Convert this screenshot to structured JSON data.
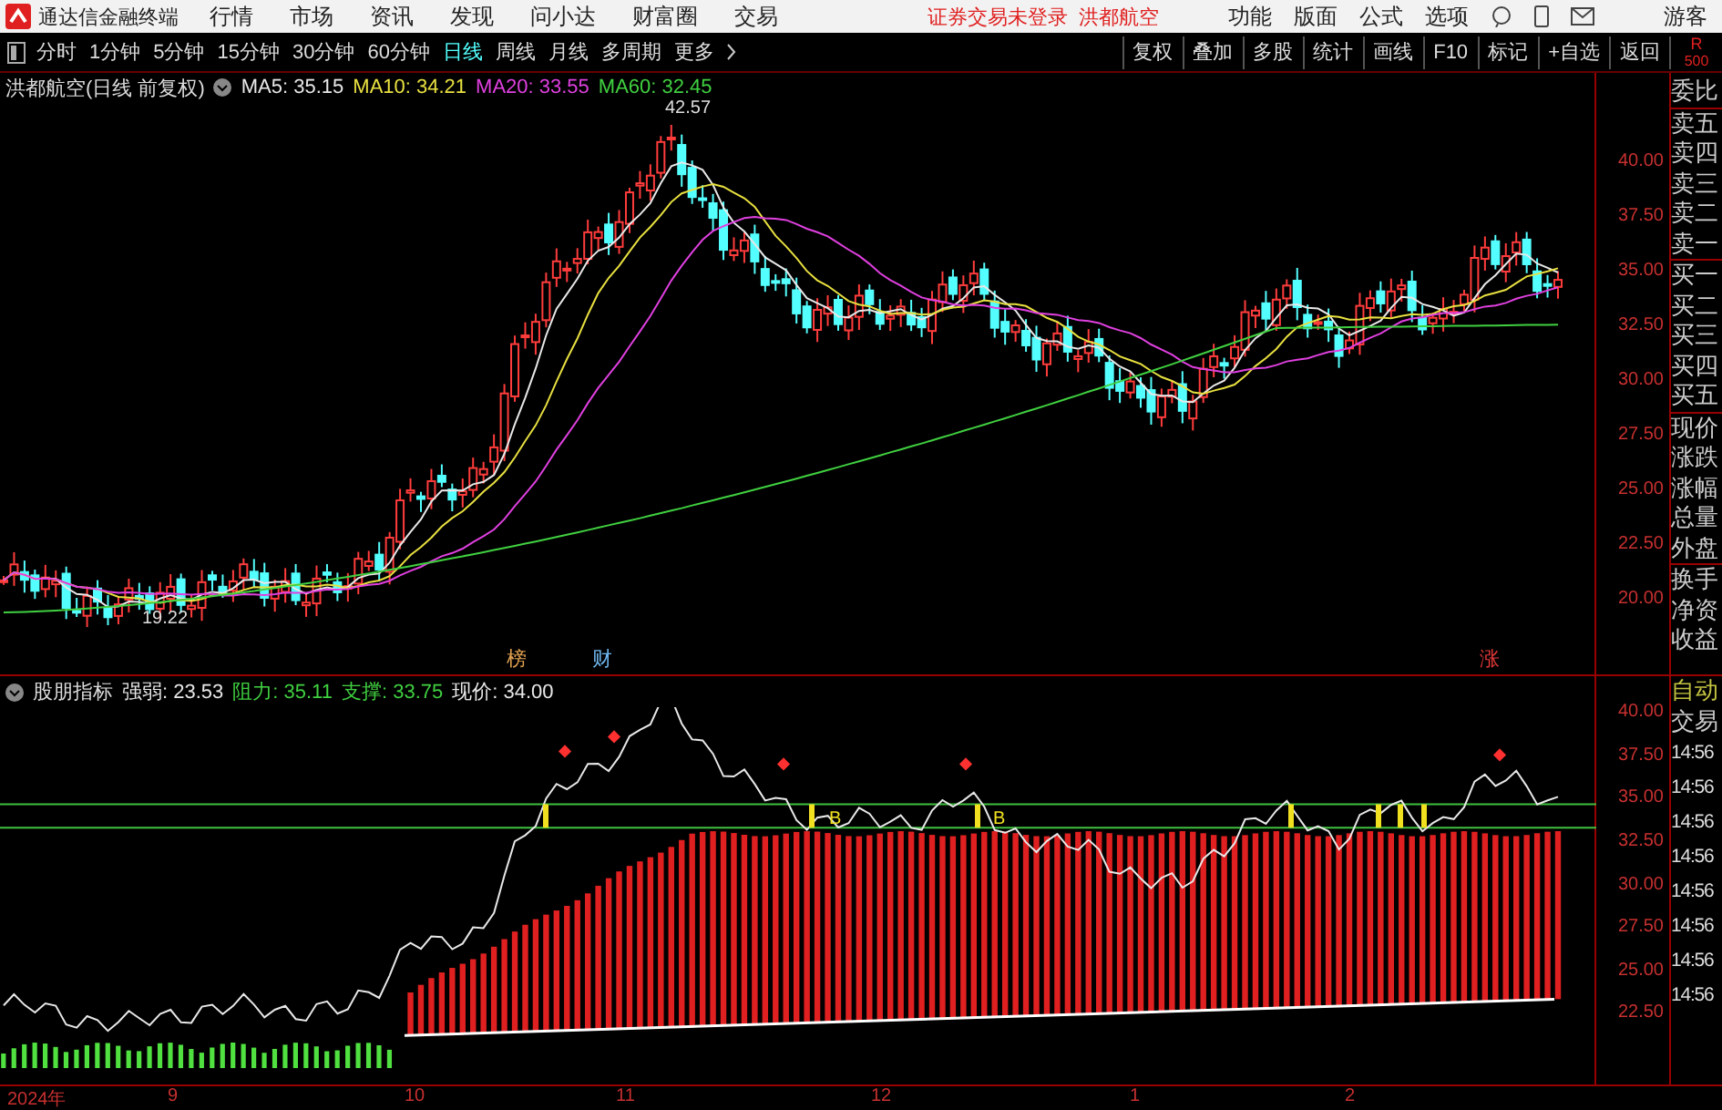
{
  "app_bar": {
    "title": "通达信金融终端",
    "menu": [
      "行情",
      "市场",
      "资讯",
      "发现",
      "问小达",
      "财富圈",
      "交易"
    ],
    "notice": "证券交易未登录",
    "stock": "洪都航空",
    "actions": [
      "功能",
      "版面",
      "公式",
      "选项"
    ],
    "user": "游客"
  },
  "toolbar": {
    "periods": [
      {
        "label": "分时",
        "selected": false
      },
      {
        "label": "1分钟",
        "selected": false
      },
      {
        "label": "5分钟",
        "selected": false
      },
      {
        "label": "15分钟",
        "selected": false
      },
      {
        "label": "30分钟",
        "selected": false
      },
      {
        "label": "60分钟",
        "selected": false
      },
      {
        "label": "日线",
        "selected": true
      },
      {
        "label": "周线",
        "selected": false
      },
      {
        "label": "月线",
        "selected": false
      },
      {
        "label": "多周期",
        "selected": false
      }
    ],
    "more": "更多",
    "buttons": [
      "复权",
      "叠加",
      "多股",
      "统计",
      "画线",
      "F10",
      "标记",
      "+自选",
      "返回"
    ],
    "corner": [
      "R",
      "500"
    ]
  },
  "main_chart": {
    "title": "洪都航空(日线 前复权)",
    "ma": [
      {
        "label": "MA5: 35.15",
        "color": "#e8e8e8"
      },
      {
        "label": "MA10: 34.21",
        "color": "#e8e040"
      },
      {
        "label": "MA20: 33.55",
        "color": "#e040e0"
      },
      {
        "label": "MA60: 32.45",
        "color": "#40d040"
      }
    ],
    "high_label": "42.57",
    "low_label": "19.22",
    "events": [
      {
        "text": "榜",
        "color": "#e0a050"
      },
      {
        "text": "财",
        "color": "#70b8f0"
      },
      {
        "text": "涨",
        "color": "#e03838"
      }
    ],
    "price_labels": [
      "40.00",
      "37.50",
      "35.00",
      "32.50",
      "30.00",
      "27.50",
      "25.00",
      "22.50",
      "20.00"
    ]
  },
  "indicator": {
    "name": "股朋指标",
    "values": [
      {
        "label": "强弱: 23.53",
        "color": "#e8e8e8"
      },
      {
        "label": "阻力: 35.11",
        "color": "#40d040"
      },
      {
        "label": "支撑: 33.75",
        "color": "#40d040"
      },
      {
        "label": "现价: 34.00",
        "color": "#e8e8e8"
      }
    ],
    "signals": [
      "B",
      "B"
    ],
    "price_labels": [
      "40.00",
      "37.50",
      "35.00",
      "32.50",
      "30.00",
      "27.50",
      "25.00",
      "22.50"
    ]
  },
  "x_axis": [
    "2024年",
    "9",
    "10",
    "11",
    "12",
    "1",
    "2"
  ],
  "side_panel": {
    "quote_labels": [
      "委比",
      "卖五",
      "卖四",
      "卖三",
      "卖二",
      "卖一",
      "买一",
      "买二",
      "买三",
      "买四",
      "买五",
      "现价",
      "涨跌",
      "涨幅",
      "总量",
      "外盘",
      "换手",
      "净资",
      "收益"
    ],
    "trade": [
      "自动",
      "交易"
    ],
    "times": [
      "14:56",
      "14:56",
      "14:56",
      "14:56",
      "14:56",
      "14:56",
      "14:56",
      "14:56"
    ]
  }
}
